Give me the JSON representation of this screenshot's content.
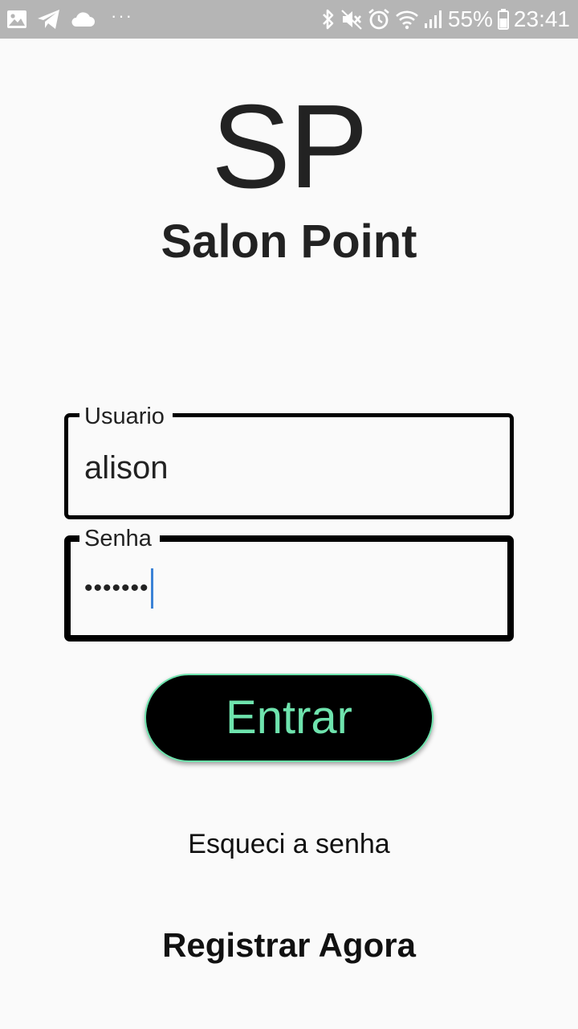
{
  "status_bar": {
    "left_icons": [
      "image-icon",
      "telegram-icon",
      "cloud-icon"
    ],
    "overflow": "···",
    "right_icons": [
      "bluetooth-icon",
      "mute-icon",
      "alarm-icon",
      "wifi-icon",
      "signal-icon"
    ],
    "battery_percent": "55%",
    "time": "23:41",
    "background": "#b5b5b5"
  },
  "logo": {
    "mark": "SP",
    "name": "Salon Point"
  },
  "login": {
    "username": {
      "label": "Usuario",
      "value": "alison"
    },
    "password": {
      "label": "Senha",
      "value": "•••••••"
    },
    "submit_label": "Entrar",
    "submit_text_color": "#6ee3ad",
    "forgot_label": "Esqueci a senha",
    "register_label": "Registrar Agora"
  }
}
